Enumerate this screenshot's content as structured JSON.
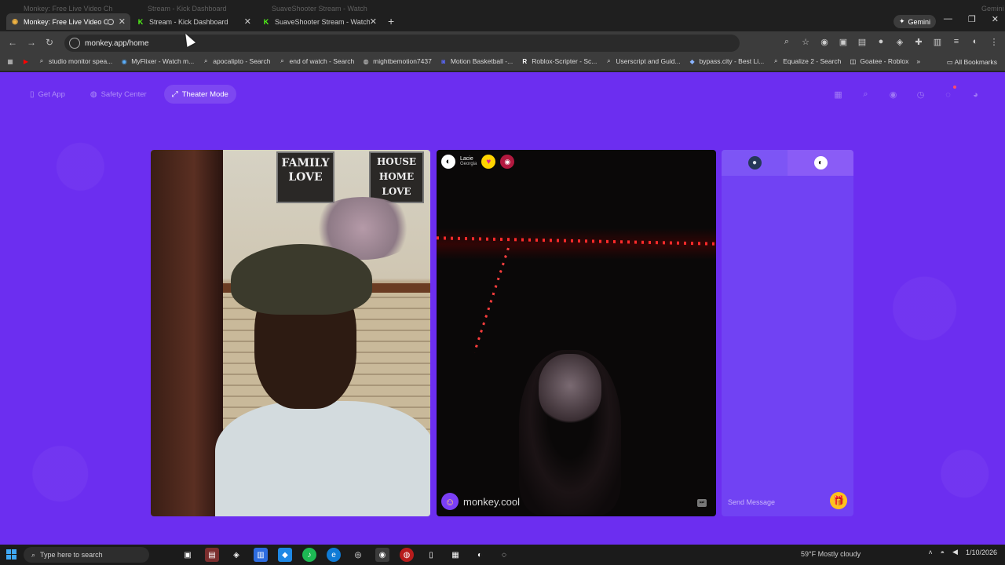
{
  "browser": {
    "ghost_tabs": [
      "Monkey: Free Live Video Ch",
      "Stream - Kick Dashboard",
      "SuaveShooter Stream - Watch",
      "Gemini"
    ],
    "tabs": [
      {
        "title": "Monkey: Free Live Video Ch",
        "icon": "monkey-favicon"
      },
      {
        "title": "Stream - Kick Dashboard",
        "icon": "kick-favicon"
      },
      {
        "title": "SuaveShooter Stream - Watch",
        "icon": "kick-favicon"
      }
    ],
    "gemini_label": "Gemini",
    "url": "monkey.app/home",
    "bookmarks": [
      {
        "label": "studio monitor spea...",
        "icon": "search-icon"
      },
      {
        "label": "MyFlixer - Watch m...",
        "icon": "myflixer-icon"
      },
      {
        "label": "apocalipto - Search",
        "icon": "search-icon"
      },
      {
        "label": "end of watch - Search",
        "icon": "search-icon"
      },
      {
        "label": "mightbemotion7437",
        "icon": "github-icon"
      },
      {
        "label": "Motion Basketball -...",
        "icon": "discord-icon"
      },
      {
        "label": "Roblox-Scripter - Sc...",
        "icon": "roblox-icon"
      },
      {
        "label": "Userscript and Guid...",
        "icon": "search-icon"
      },
      {
        "label": "bypass.city - Best Li...",
        "icon": "bypass-icon"
      },
      {
        "label": "Equalize 2 - Search",
        "icon": "search-icon"
      },
      {
        "label": "Goatee - Roblox",
        "icon": "roblox-icon"
      }
    ],
    "all_bookmarks": "All Bookmarks"
  },
  "nav": {
    "get_app": "Get App",
    "safety_center": "Safety Center",
    "theater_mode": "Theater Mode"
  },
  "left_video": {
    "frame1_text": "FAMILY\nLOVE",
    "frame2_text": "HOUSE\nHOME\nLOVE"
  },
  "peer": {
    "name": "Lacie",
    "location": "Georgia",
    "watermark": "monkey.cool"
  },
  "chat": {
    "placeholder": "Send Message"
  },
  "taskbar": {
    "search_placeholder": "Type here to search",
    "weather": "59°F Mostly cloudy",
    "date": "1/10/2026"
  }
}
